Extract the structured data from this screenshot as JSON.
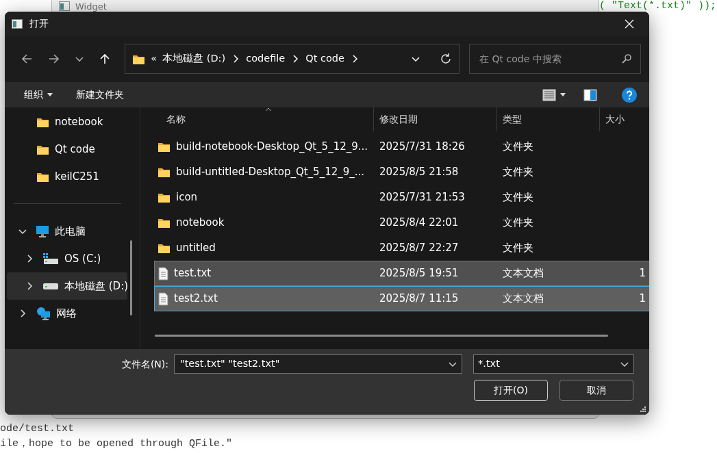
{
  "editor": {
    "top_line": "( \"Text(*.txt)\" ));",
    "bottom_lines": [
      "ode/test.txt",
      "ile，hope to be opened through QFile.\""
    ]
  },
  "window": {
    "title": "Widget"
  },
  "dialog": {
    "title": "打开",
    "address": {
      "overflow": "«",
      "crumbs": [
        "本地磁盘 (D:)",
        "codefile",
        "Qt code"
      ]
    },
    "search": {
      "placeholder": "在 Qt code 中搜索"
    },
    "toolbar": {
      "organize": "组织",
      "new_folder": "新建文件夹"
    },
    "sidebar": [
      {
        "kind": "folder",
        "label": "notebook",
        "selected": false
      },
      {
        "kind": "folder",
        "label": "Qt code",
        "selected": false
      },
      {
        "kind": "folder",
        "label": "keilC251",
        "selected": false
      },
      {
        "kind": "divider"
      },
      {
        "kind": "computer",
        "label": "此电脑",
        "expanded": true,
        "selected": false,
        "children": [
          {
            "kind": "system-drive",
            "label": "OS (C:)",
            "expanded": false,
            "selected": false
          },
          {
            "kind": "drive",
            "label": "本地磁盘 (D:)",
            "expanded": false,
            "selected": true
          }
        ]
      },
      {
        "kind": "network",
        "label": "网络",
        "expanded": false,
        "selected": false
      }
    ],
    "columns": [
      "名称",
      "修改日期",
      "类型",
      "大小"
    ],
    "rows": [
      {
        "kind": "folder",
        "name": "build-notebook-Desktop_Qt_5_12_9...",
        "date": "2025/7/31 18:26",
        "type": "文件夹",
        "selected": false,
        "focused": false
      },
      {
        "kind": "folder",
        "name": "build-untitled-Desktop_Qt_5_12_9_...",
        "date": "2025/8/5 21:58",
        "type": "文件夹",
        "selected": false,
        "focused": false
      },
      {
        "kind": "folder",
        "name": "icon",
        "date": "2025/7/31 21:53",
        "type": "文件夹",
        "selected": false,
        "focused": false
      },
      {
        "kind": "folder",
        "name": "notebook",
        "date": "2025/8/4 22:01",
        "type": "文件夹",
        "selected": false,
        "focused": false
      },
      {
        "kind": "folder",
        "name": "untitled",
        "date": "2025/8/7 22:27",
        "type": "文件夹",
        "selected": false,
        "focused": false
      },
      {
        "kind": "file",
        "name": "test.txt",
        "date": "2025/8/5 19:51",
        "type": "文本文档",
        "size": "1",
        "selected": true,
        "focused": false
      },
      {
        "kind": "file",
        "name": "test2.txt",
        "date": "2025/8/7 11:15",
        "type": "文本文档",
        "size": "1",
        "selected": true,
        "focused": true
      }
    ],
    "filename": {
      "label": "文件名(N):",
      "value": "\"test.txt\" \"test2.txt\""
    },
    "filter": {
      "value": "*.txt"
    },
    "buttons": [
      {
        "label": "打开(O)",
        "default": true
      },
      {
        "label": "取消",
        "default": false
      }
    ]
  }
}
